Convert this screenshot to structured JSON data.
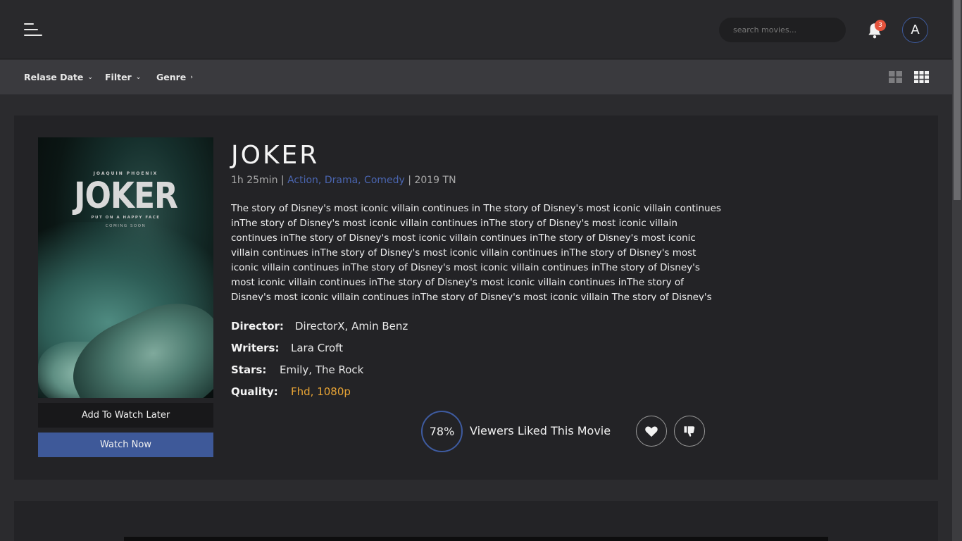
{
  "header": {
    "menu_icon": "hamburger-menu-icon",
    "search_placeholder": "search movies...",
    "notification_count": "3",
    "avatar_letter": "A"
  },
  "filters": {
    "release_date": "Relase Date",
    "filter": "Filter",
    "genre": "Genre"
  },
  "movie": {
    "poster": {
      "actor": "JOAQUIN PHOENIX",
      "title": "JOKER",
      "tagline": "PUT ON A HAPPY FACE",
      "coming": "COMING SOON"
    },
    "title": "JOKER",
    "duration": "1h  25min",
    "separator": "|",
    "genres": "Action,  Drama,  Comedy",
    "year_country": "2019  TN",
    "description": "The story of Disney's most iconic villain continues in The story of Disney's most iconic villain continues inThe story of Disney's most iconic villain continues inThe story of Disney's most iconic villain continues inThe story of Disney's most iconic villain continues inThe story of Disney's most iconic villain continues inThe story of Disney's most iconic villain continues inThe story of Disney's most iconic villain continues inThe story of Disney's most iconic villain continues inThe story of Disney's most iconic villain continues inThe story of Disney's most iconic villain continues inThe story of Disney's most iconic villain continues inThe story of Disney's most iconic villain The story of Disney's",
    "director_label": "Director:",
    "director": "DirectorX, Amin Benz",
    "writers_label": "Writers:",
    "writers": "Lara Croft",
    "stars_label": "Stars:",
    "stars": "Emily, The Rock",
    "quality_label": "Quality:",
    "quality": "Fhd, 1080p",
    "watch_later": "Add To Watch Later",
    "watch_now": "Watch Now",
    "rating_percent": "78%",
    "rating_text": "Viewers Liked This Movie"
  },
  "colors": {
    "accent": "#3e5999",
    "genre": "#4a65b0",
    "quality": "#e8a435",
    "badge": "#e5533c"
  }
}
